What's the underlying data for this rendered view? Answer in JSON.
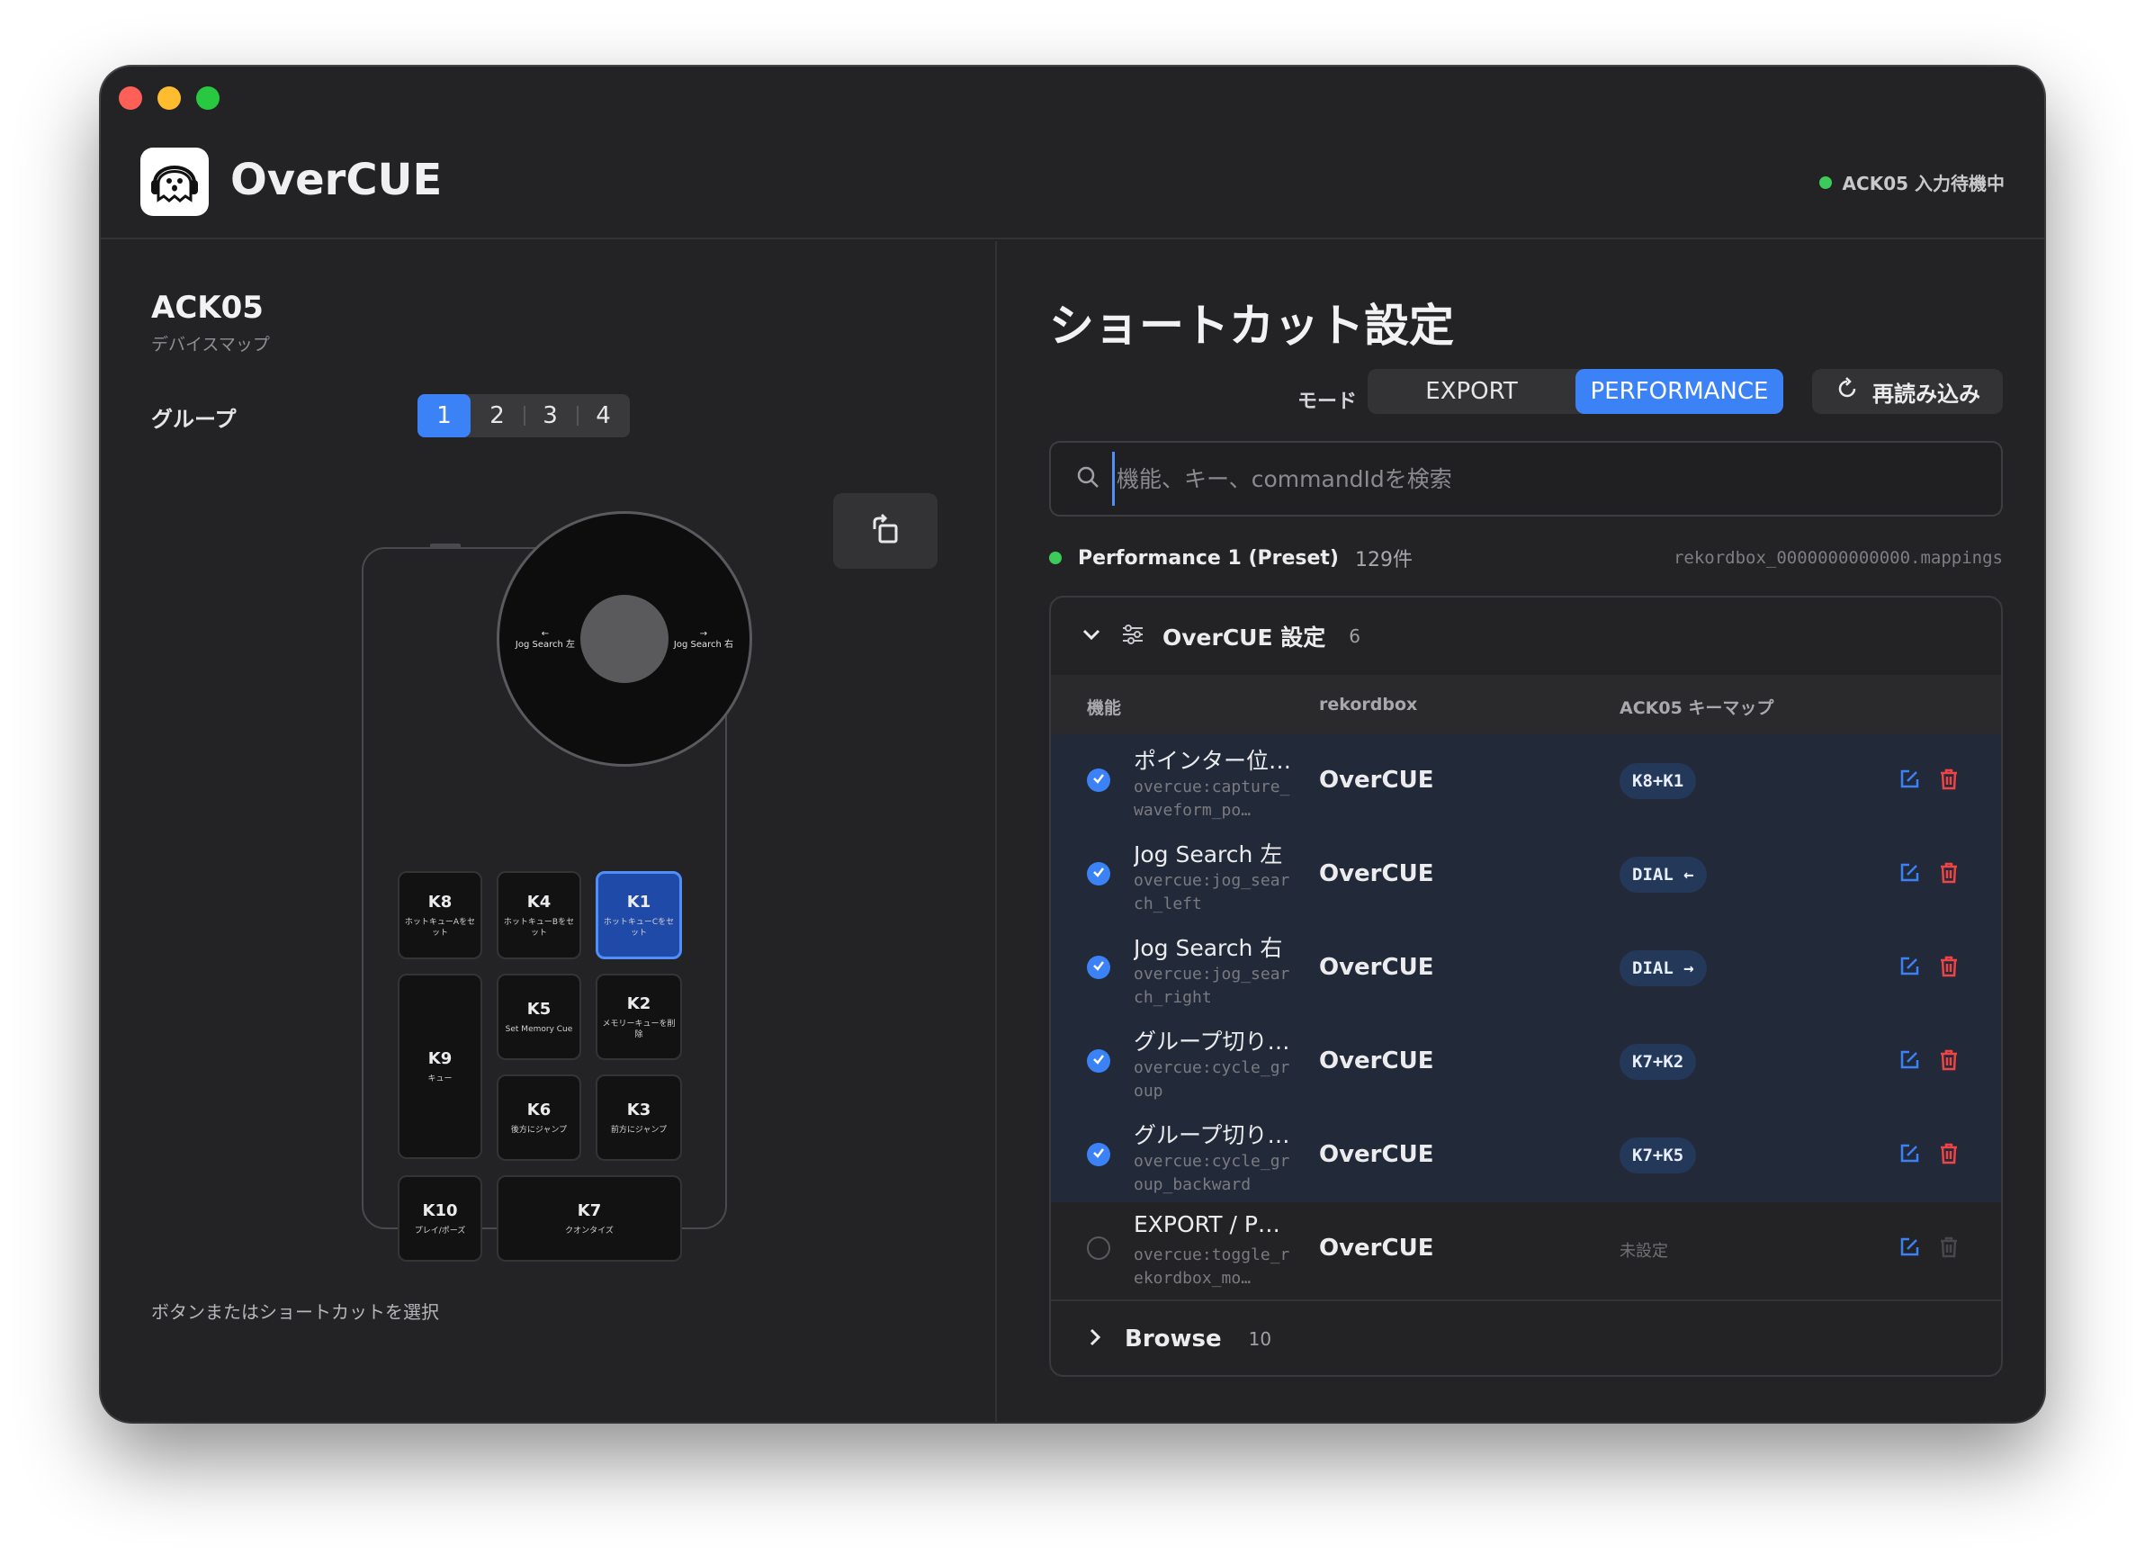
{
  "app": {
    "title": "OverCUE",
    "status": "ACK05 入力待機中",
    "status_color": "#3ccb5a",
    "accent": "#3b82f6"
  },
  "device": {
    "name": "ACK05",
    "subtitle": "デバイスマップ",
    "group_label": "グループ",
    "groups": [
      "1",
      "2",
      "3",
      "4"
    ],
    "active_group": "1",
    "dial": {
      "left": "Jog Search 左",
      "right": "Jog Search 右",
      "left_arrow": "←",
      "right_arrow": "→"
    },
    "keys": {
      "k8": {
        "name": "K8",
        "desc": "ホットキューAをセット"
      },
      "k4": {
        "name": "K4",
        "desc": "ホットキューBをセット"
      },
      "k1": {
        "name": "K1",
        "desc": "ホットキューCをセット"
      },
      "k9": {
        "name": "K9",
        "desc": "キュー"
      },
      "k5": {
        "name": "K5",
        "desc": "Set Memory Cue"
      },
      "k2": {
        "name": "K2",
        "desc": "メモリーキューを削除"
      },
      "k6": {
        "name": "K6",
        "desc": "後方にジャンプ"
      },
      "k3": {
        "name": "K3",
        "desc": "前方にジャンプ"
      },
      "k10": {
        "name": "K10",
        "desc": "プレイ/ポーズ"
      },
      "k7": {
        "name": "K7",
        "desc": "クオンタイズ"
      }
    },
    "selected_key": "K1",
    "hint": "ボタンまたはショートカットを選択"
  },
  "shortcuts": {
    "title": "ショートカット設定",
    "mode_label": "モード",
    "modes": [
      "EXPORT",
      "PERFORMANCE"
    ],
    "active_mode": "PERFORMANCE",
    "reload_label": "再読み込み",
    "search_placeholder": "機能、キー、commandIdを検索",
    "search_value": "",
    "preset": {
      "name": "Performance 1 (Preset)",
      "count": "129件",
      "file": "rekordbox_0000000000000.mappings"
    },
    "section": {
      "title": "OverCUE 設定",
      "count": "6",
      "columns": [
        "機能",
        "rekordbox",
        "ACK05 キーマップ"
      ],
      "rows": [
        {
          "checked": true,
          "name": "ポインター位…",
          "command": "overcue:capture_waveform_po…",
          "rekordbox": "OverCUE",
          "key": "K8+K1"
        },
        {
          "checked": true,
          "name": "Jog Search 左",
          "command": "overcue:jog_search_left",
          "rekordbox": "OverCUE",
          "key": "DIAL ←"
        },
        {
          "checked": true,
          "name": "Jog Search 右",
          "command": "overcue:jog_search_right",
          "rekordbox": "OverCUE",
          "key": "DIAL →"
        },
        {
          "checked": true,
          "name": "グループ切り…",
          "command": "overcue:cycle_group",
          "rekordbox": "OverCUE",
          "key": "K7+K2"
        },
        {
          "checked": true,
          "name": "グループ切り…",
          "command": "overcue:cycle_group_backward",
          "rekordbox": "OverCUE",
          "key": "K7+K5"
        },
        {
          "checked": false,
          "name": "EXPORT / P…",
          "command": "overcue:toggle_rekordbox_mo…",
          "rekordbox": "OverCUE",
          "key": "未設定"
        }
      ]
    },
    "browse": {
      "title": "Browse",
      "count": "10"
    }
  },
  "icons": [
    "ghost-headphones-logo-icon",
    "rotate-icon",
    "refresh-icon",
    "search-icon",
    "chevron-down-icon",
    "sliders-icon",
    "check-icon",
    "edit-icon",
    "trash-icon",
    "chevron-right-icon"
  ]
}
